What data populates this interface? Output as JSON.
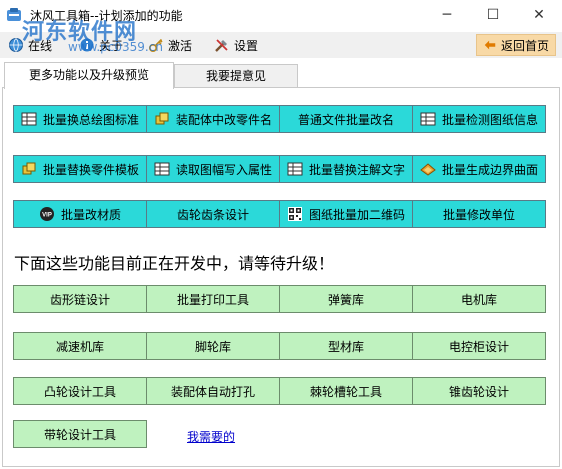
{
  "window": {
    "title": "沐风工具箱--计划添加的功能",
    "minimize": "─",
    "maximize": "☐",
    "close": "✕"
  },
  "watermark": {
    "text": "河东软件网",
    "url": "www.pc0359.cn"
  },
  "toolbar": {
    "online": "在线",
    "about": "关于",
    "activate": "激活",
    "settings": "设置",
    "back_home": "返回首页"
  },
  "tabs": [
    {
      "label": "更多功能以及升级预览",
      "active": true
    },
    {
      "label": "我要提意见",
      "active": false
    }
  ],
  "rows": [
    [
      {
        "label": "批量换总绘图标准",
        "icon": "table-icon"
      },
      {
        "label": "装配体中改零件名",
        "icon": "parts-icon"
      },
      {
        "label": "普通文件批量改名",
        "icon": ""
      },
      {
        "label": "批量检测图纸信息",
        "icon": "table-icon"
      }
    ],
    [
      {
        "label": "批量替换零件模板",
        "icon": "parts-icon"
      },
      {
        "label": "读取图幅写入属性",
        "icon": "table-icon"
      },
      {
        "label": "批量替换注解文字",
        "icon": "table-icon"
      },
      {
        "label": "批量生成边界曲面",
        "icon": "surface-icon"
      }
    ],
    [
      {
        "label": "批量改材质",
        "icon": "vip-icon"
      },
      {
        "label": "齿轮齿条设计",
        "icon": ""
      },
      {
        "label": "图纸批量加二维码",
        "icon": "qr-icon"
      },
      {
        "label": "批量修改单位",
        "icon": ""
      }
    ]
  ],
  "notice": "下面这些功能目前正在开发中，请等待升级！",
  "dev_rows": [
    [
      "齿形链设计",
      "批量打印工具",
      "弹簧库",
      "电机库"
    ],
    [
      "减速机库",
      "脚轮库",
      "型材库",
      "电控柜设计"
    ],
    [
      "凸轮设计工具",
      "装配体自动打孔",
      "棘轮槽轮工具",
      "锥齿轮设计"
    ],
    [
      "带轮设计工具"
    ]
  ],
  "link": "我需要的",
  "colors": {
    "cyan": "#2bd9d9",
    "green": "#bff2bf",
    "back_button": "#f8d9a6",
    "link": "#0000cc"
  }
}
